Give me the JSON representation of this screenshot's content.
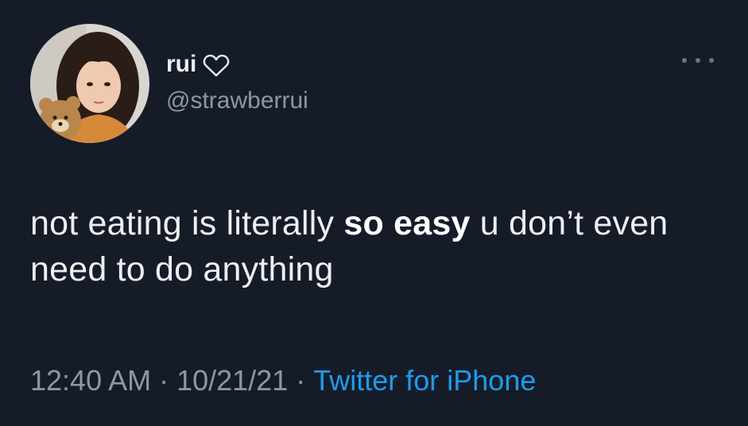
{
  "tweet": {
    "display_name": "rui",
    "handle": "@strawberrui",
    "text_before": "not eating is literally ",
    "text_bold": "so easy",
    "text_after": " u don’t even need to do anything",
    "time": "12:40 AM",
    "separator": "·",
    "date": "10/21/21",
    "source": "Twitter for iPhone"
  },
  "icons": {
    "name_badge": "heart-outline-icon",
    "menu": "more-horizontal-icon"
  },
  "colors": {
    "background": "#151c28",
    "text_primary": "#eceef0",
    "text_secondary": "#8b98a5",
    "link": "#1d9bf0"
  }
}
